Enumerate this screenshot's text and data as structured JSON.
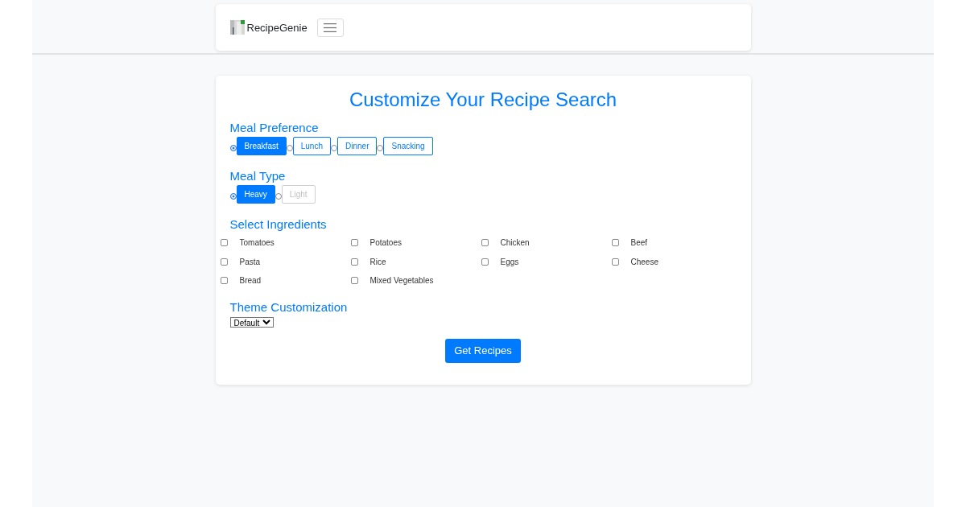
{
  "navbar": {
    "brand": "RecipeGenie"
  },
  "title": "Customize Your Recipe Search",
  "meal_preference": {
    "heading": "Meal Preference",
    "options": [
      {
        "label": "Breakfast",
        "selected": true
      },
      {
        "label": "Lunch",
        "selected": false
      },
      {
        "label": "Dinner",
        "selected": false
      },
      {
        "label": "Snacking",
        "selected": false
      }
    ]
  },
  "meal_type": {
    "heading": "Meal Type",
    "options": [
      {
        "label": "Heavy",
        "selected": true,
        "disabled": false
      },
      {
        "label": "Light",
        "selected": false,
        "disabled": true
      }
    ]
  },
  "ingredients": {
    "heading": "Select Ingredients",
    "items": [
      {
        "label": "Tomatoes",
        "checked": false
      },
      {
        "label": "Potatoes",
        "checked": false
      },
      {
        "label": "Chicken",
        "checked": false
      },
      {
        "label": "Beef",
        "checked": false
      },
      {
        "label": "Pasta",
        "checked": false
      },
      {
        "label": "Rice",
        "checked": false
      },
      {
        "label": "Eggs",
        "checked": false
      },
      {
        "label": "Cheese",
        "checked": false
      },
      {
        "label": "Bread",
        "checked": false
      },
      {
        "label": "Mixed Vegetables",
        "checked": false
      }
    ]
  },
  "theme": {
    "heading": "Theme Customization",
    "select": {
      "value": "Default"
    }
  },
  "submit_button": "Get Recipes"
}
